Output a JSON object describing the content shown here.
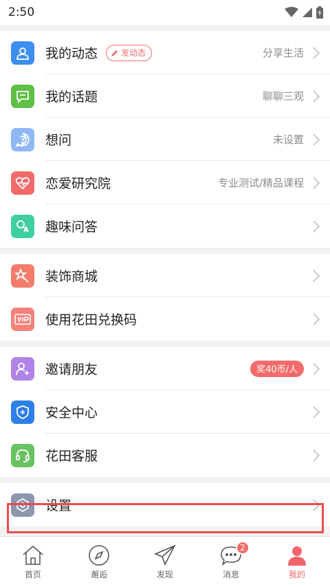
{
  "status_bar": {
    "time": "2:50"
  },
  "menu": {
    "group1": [
      {
        "label": "我的动态",
        "tag": "发动态",
        "right": "分享生活",
        "icon": "person-icon",
        "color": "#3d8ef0"
      },
      {
        "label": "我的话题",
        "right": "聊聊三观",
        "icon": "chat-icon",
        "color": "#5fbf46"
      },
      {
        "label": "想问",
        "right": "未设置",
        "icon": "question-icon",
        "color": "#8fb8f5"
      },
      {
        "label": "恋爱研究院",
        "right": "专业测试/精品课程",
        "icon": "heartbeat-icon",
        "color": "#f26b6b"
      },
      {
        "label": "趣味问答",
        "right": "",
        "icon": "quiz-icon",
        "color": "#3fcf9e"
      }
    ],
    "group2": [
      {
        "label": "装饰商城",
        "icon": "star-wand-icon",
        "color": "#f47c6a"
      },
      {
        "label": "使用花田兑换码",
        "icon": "vip-icon",
        "color": "#f5827a"
      }
    ],
    "group3": [
      {
        "label": "邀请朋友",
        "badge": "奖40币/人",
        "icon": "add-person-icon",
        "color": "#b083e8"
      },
      {
        "label": "安全中心",
        "icon": "shield-icon",
        "color": "#2f7fe8"
      },
      {
        "label": "花田客服",
        "icon": "headset-icon",
        "color": "#69c261"
      }
    ],
    "group4": [
      {
        "label": "设置",
        "icon": "gear-icon",
        "color": "#8d96ad"
      }
    ]
  },
  "tabbar": {
    "tabs": [
      {
        "label": "首页",
        "icon": "home-icon"
      },
      {
        "label": "邂逅",
        "icon": "compass-icon"
      },
      {
        "label": "发现",
        "icon": "paper-plane-icon"
      },
      {
        "label": "消息",
        "icon": "message-icon",
        "badge": "2"
      },
      {
        "label": "我的",
        "icon": "profile-icon",
        "active": true
      }
    ]
  },
  "colors": {
    "accent": "#f0646a",
    "highlight": "#e94c4c"
  }
}
